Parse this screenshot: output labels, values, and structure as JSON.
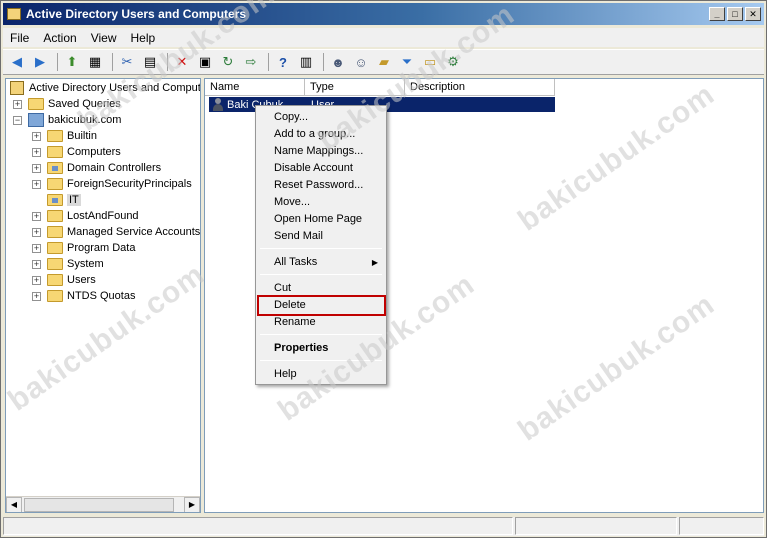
{
  "window": {
    "title": "Active Directory Users and Computers",
    "minimize": "_",
    "maximize": "□",
    "close": "✕"
  },
  "menubar": [
    "File",
    "Action",
    "View",
    "Help"
  ],
  "toolbar": {
    "icons": [
      "back-icon",
      "forward-icon",
      "up-icon",
      "show-tree-icon",
      "cut-icon",
      "copy-icon",
      "delete-icon",
      "properties-icon",
      "refresh-icon",
      "export-icon",
      "help-icon",
      "console-help-icon",
      "users-icon",
      "new-user-icon",
      "new-group-icon",
      "new-ou-icon",
      "filter-icon",
      "find-icon",
      "add-to-group-icon"
    ]
  },
  "tree": {
    "root": "Active Directory Users and Comput",
    "items": [
      {
        "label": "Saved Queries",
        "level": 1,
        "expander": "+"
      },
      {
        "label": "bakicubuk.com",
        "level": 1,
        "expander": "−",
        "type": "domain"
      },
      {
        "label": "Builtin",
        "level": 2,
        "expander": "+"
      },
      {
        "label": "Computers",
        "level": 2,
        "expander": "+"
      },
      {
        "label": "Domain Controllers",
        "level": 2,
        "expander": "+",
        "type": "ou"
      },
      {
        "label": "ForeignSecurityPrincipals",
        "level": 2,
        "expander": "+"
      },
      {
        "label": "IT",
        "level": 2,
        "expander": "",
        "type": "ou",
        "selected": true
      },
      {
        "label": "LostAndFound",
        "level": 2,
        "expander": "+"
      },
      {
        "label": "Managed Service Accounts",
        "level": 2,
        "expander": "+"
      },
      {
        "label": "Program Data",
        "level": 2,
        "expander": "+"
      },
      {
        "label": "System",
        "level": 2,
        "expander": "+"
      },
      {
        "label": "Users",
        "level": 2,
        "expander": "+"
      },
      {
        "label": "NTDS Quotas",
        "level": 2,
        "expander": "+"
      }
    ]
  },
  "list": {
    "columns": [
      "Name",
      "Type",
      "Description"
    ],
    "rows": [
      {
        "name": "Baki Cubuk",
        "type": "User",
        "description": ""
      }
    ]
  },
  "context_menu": {
    "items": [
      "Copy...",
      "Add to a group...",
      "Name Mappings...",
      "Disable Account",
      "Reset Password...",
      "Move...",
      "Open Home Page",
      "Send Mail"
    ],
    "all_tasks": "All Tasks",
    "cut": "Cut",
    "delete": "Delete",
    "rename": "Rename",
    "properties": "Properties",
    "help": "Help",
    "highlighted": "Delete",
    "highlight_color": "#c00000"
  },
  "watermark": "bakicubuk.com"
}
